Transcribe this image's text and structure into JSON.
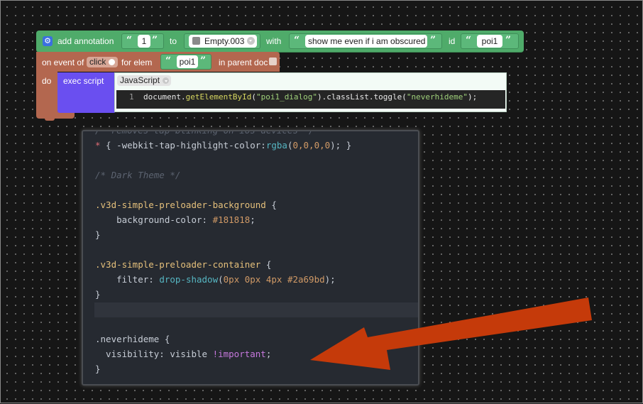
{
  "blocks": {
    "annotation": {
      "label": "add annotation",
      "text_value": "1",
      "to_label": "to",
      "object_value": "Empty.003",
      "with_label": "with",
      "content_value": "show me even if i am obscured",
      "id_label": "id",
      "id_value": "poi1",
      "icon": "gear-icon"
    },
    "event": {
      "on_label": "on event of",
      "event_value": "click",
      "for_label": "for elem",
      "elem_value": "poi1",
      "parent_label": "in parent doc",
      "do_label": "do"
    },
    "script": {
      "label": "exec script",
      "language": "JavaScript",
      "line_number": "1",
      "code": {
        "prefix": "document.",
        "method": "getElementById",
        "arg": "\"poi1_dialog\"",
        "chain": ").classList.toggle(",
        "class_arg": "\"neverhideme\"",
        "suffix": ");"
      }
    }
  },
  "editor": {
    "lines": {
      "l0": "/* removes tap blinking on ios devices */",
      "l1_sel": "*",
      "l1_rest_a": " { -webkit-tap-highlight-color:",
      "l1_fn": "rgba",
      "l1_paren_open": "(",
      "l1_nums": "0,0,0,0",
      "l1_end": "); }",
      "l3": "/* Dark Theme */",
      "l5_cls": ".v3d-simple-preloader-background",
      "l5_brace": " {",
      "l6_prop": "    background-color: ",
      "l6_val": "#181818",
      "l6_semi": ";",
      "l7": "}",
      "l9_cls": ".v3d-simple-preloader-container",
      "l9_brace": " {",
      "l10_prop": "    filter: ",
      "l10_fn": "drop-shadow",
      "l10_open": "(",
      "l10_vals": "0px 0px 4px #2a69bd",
      "l10_end": ");",
      "l11": "}",
      "l14_cls": ".neverhideme",
      "l14_brace": " {",
      "l15_prop": "  visibility: visible ",
      "l15_imp": "!important",
      "l15_semi": ";",
      "l16": "}"
    }
  },
  "colors": {
    "annotation_block": "#4fab6a",
    "event_block": "#b3674f",
    "script_block": "#6a4ff0",
    "arrow": "#c53a0a",
    "editor_bg": "#262a31"
  }
}
